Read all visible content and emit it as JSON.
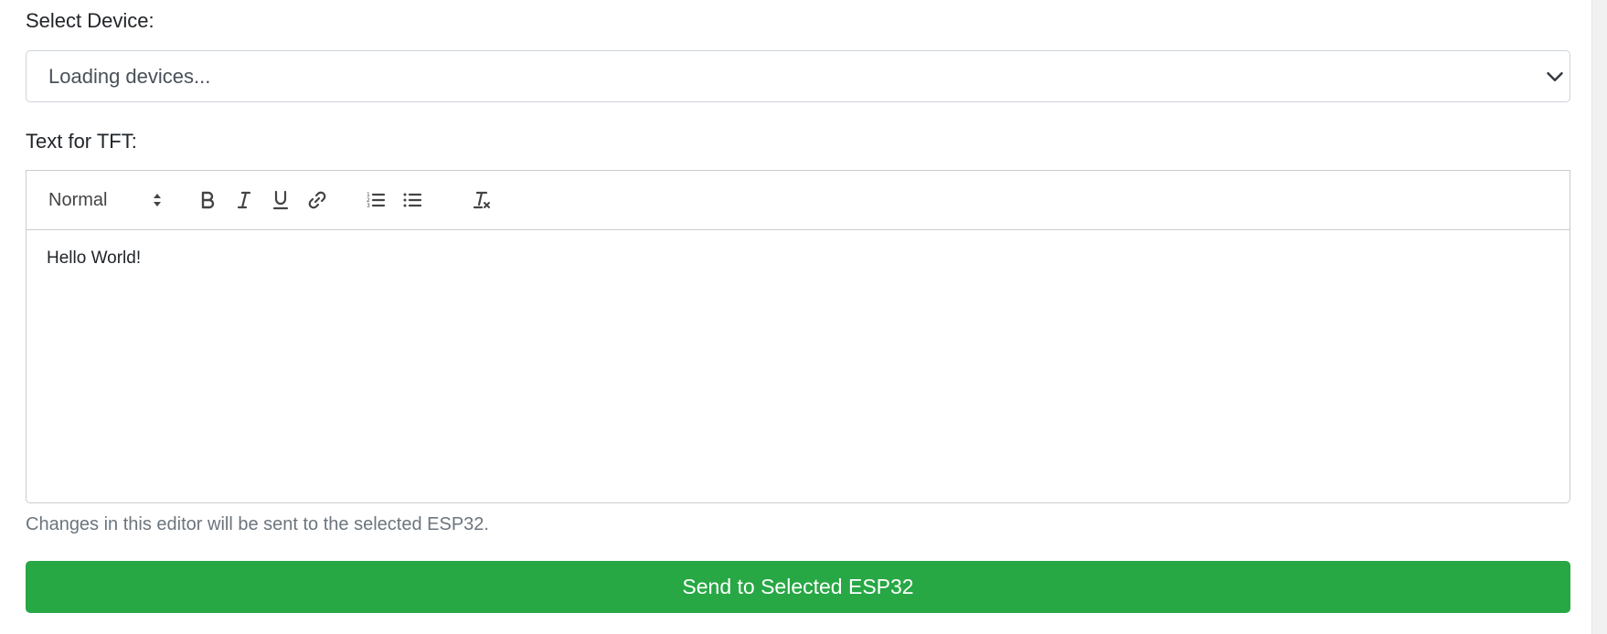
{
  "device": {
    "label": "Select Device:",
    "selected": "Loading devices...",
    "chevron_icon": "chevron-down-icon"
  },
  "editor": {
    "label": "Text for TFT:",
    "format_value": "Normal",
    "toolbar": [
      {
        "icon": "bold-icon"
      },
      {
        "icon": "italic-icon"
      },
      {
        "icon": "underline-icon"
      },
      {
        "icon": "link-icon"
      },
      {
        "icon": "ordered-list-icon"
      },
      {
        "icon": "bullet-list-icon"
      },
      {
        "icon": "clear-format-icon"
      }
    ],
    "content": "Hello World!",
    "hint": "Changes in this editor will be sent to the selected ESP32."
  },
  "send_button": {
    "label": "Send to Selected ESP32",
    "color": "#28a745"
  }
}
